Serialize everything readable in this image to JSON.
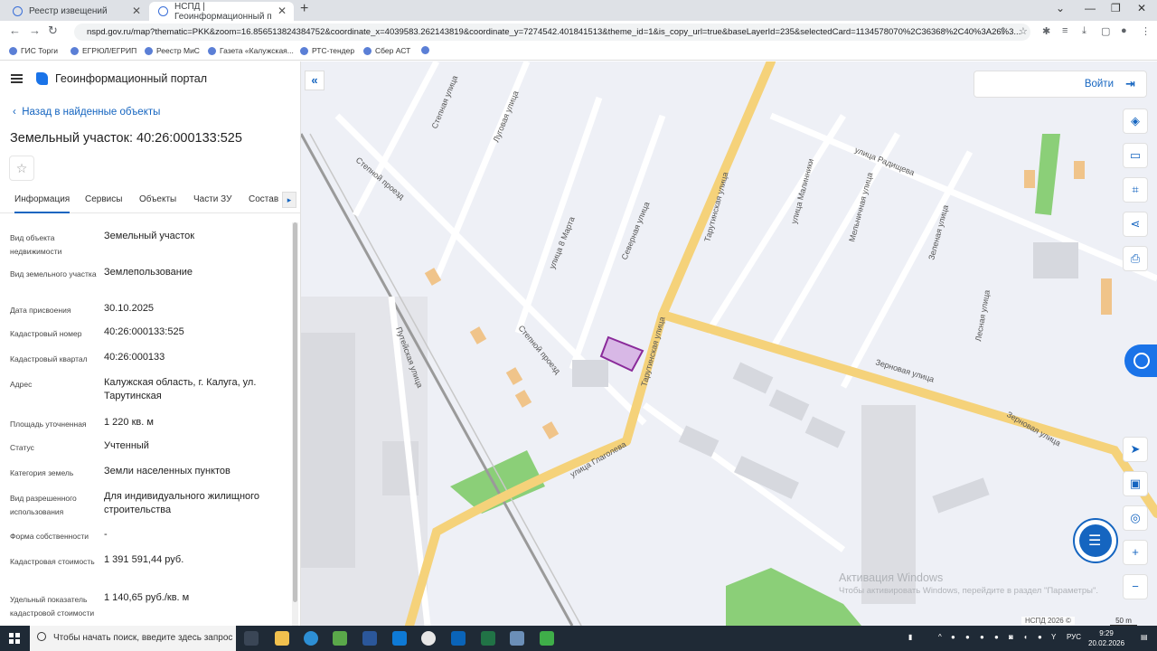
{
  "browser": {
    "tabs": [
      {
        "label": "Реестр извещений"
      },
      {
        "label": "НСПД | Геоинформационный п"
      }
    ],
    "url": "nspd.gov.ru/map?thematic=PKK&zoom=16.856513824384752&coordinate_x=4039583.262143819&coordinate_y=7274542.401841513&theme_id=1&is_copy_url=true&baseLayerId=235&selectedCard=1134578070%2C36368%2C40%3A26%3...",
    "bookmarks": [
      "ГИС Торги",
      "ЕГРЮЛ/ЕГРИП",
      "Реестр МиС",
      "Газета «Калужская...",
      "РТС-тендер",
      "Сбер АСТ"
    ]
  },
  "portal": {
    "title": "Геоинформационный портал",
    "back_label": "Назад в найденные объекты",
    "object_title": "Земельный участок: 40:26:000133:525"
  },
  "tabs": [
    "Информация",
    "Сервисы",
    "Объекты",
    "Части ЗУ",
    "Состав"
  ],
  "attributes": [
    {
      "key": "Вид объекта недвижимости",
      "value": "Земельный участок"
    },
    {
      "key": "Вид земельного участка",
      "value": "Землепользование"
    },
    {
      "key": "Дата присвоения",
      "value": "30.10.2025"
    },
    {
      "key": "Кадастровый номер",
      "value": "40:26:000133:525"
    },
    {
      "key": "Кадастровый квартал",
      "value": "40:26:000133"
    },
    {
      "key": "Адрес",
      "value": "Калужская область, г. Калуга, ул. Тарутинская"
    },
    {
      "key": "Площадь уточненная",
      "value": "1 220 кв. м"
    },
    {
      "key": "Статус",
      "value": "Учтенный"
    },
    {
      "key": "Категория земель",
      "value": "Земли населенных пунктов"
    },
    {
      "key": "Вид разрешенного использования",
      "value": "Для индивидуального жилищного строительства"
    },
    {
      "key": "Форма собственности",
      "value": "-"
    },
    {
      "key": "Кадастровая стоимость",
      "value": "1 391 591,44 руб."
    },
    {
      "key": "Удельный показатель кадастровой стоимости",
      "value": "1 140,65 руб./кв. м"
    }
  ],
  "map": {
    "login_label": "Войти",
    "streets": [
      "Степной проезд",
      "улица 8 Марта",
      "Северная улица",
      "Тарутинская улица",
      "Зерновая улица",
      "улица Глаголева",
      "Путейская улица",
      "улица Радищева",
      "Луговая улица",
      "Степная улица",
      "улица Малинники",
      "Мельничная улица",
      "Зеленая улица",
      "Лесная улица"
    ],
    "watermark_title": "Активация Windows",
    "watermark_text": "Чтобы активировать Windows, перейдите в раздел \"Параметры\".",
    "copyright": "НСПД 2026 ©",
    "scale": "50 m"
  },
  "taskbar": {
    "search_placeholder": "Чтобы начать поиск, введите здесь запрос",
    "lang": "РУС",
    "time": "9:29",
    "date": "20.02.2026"
  }
}
